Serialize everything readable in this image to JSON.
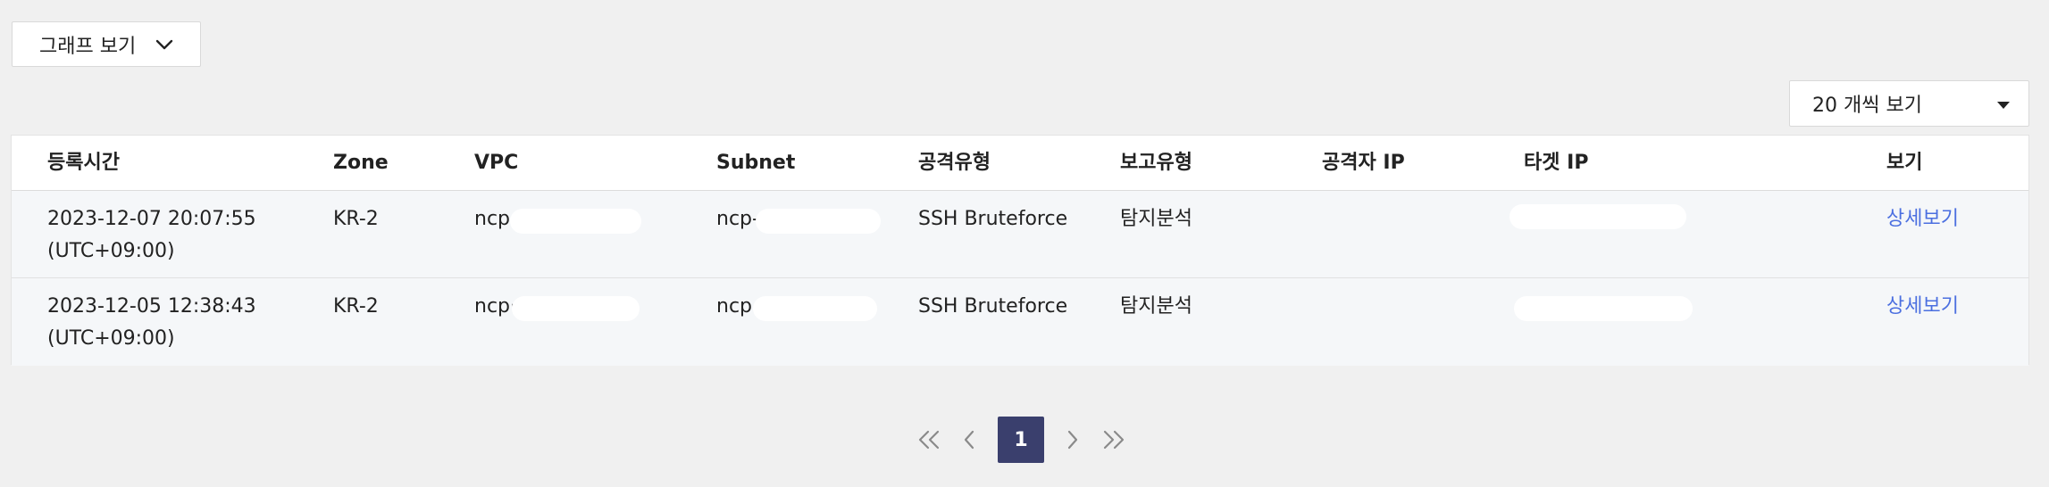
{
  "graph_toggle": {
    "label": "그래프 보기",
    "icon": "chevron-down-icon"
  },
  "page_size": {
    "selected": "20 개씩 보기",
    "icon": "caret-down-icon"
  },
  "table": {
    "columns": [
      "등록시간",
      "Zone",
      "VPC",
      "Subnet",
      "공격유형",
      "보고유형",
      "공격자 IP",
      "타겟 IP",
      "보기"
    ],
    "rows": [
      {
        "date": "2023-12-07 20:07:55",
        "tz": "(UTC+09:00)",
        "zone": "KR-2",
        "vpc": "ncp",
        "subnet": "ncp-",
        "attack_type": "SSH Bruteforce",
        "report_type": "탐지분석",
        "attacker_ip": "",
        "view": "상세보기"
      },
      {
        "date": "2023-12-05 12:38:43",
        "tz": "(UTC+09:00)",
        "zone": "KR-2",
        "vpc": "ncp·",
        "subnet": "ncp·",
        "attack_type": "SSH Bruteforce",
        "report_type": "탐지분석",
        "attacker_ip": "",
        "view": "상세보기"
      }
    ]
  },
  "pagination": {
    "current_page": "1",
    "icons": [
      "double-chevron-left-icon",
      "chevron-left-icon",
      "chevron-right-icon",
      "double-chevron-right-icon"
    ]
  },
  "colors": {
    "background": "#f0f0f0",
    "link": "#4b6fe0",
    "page_active": "#3a3f6d",
    "row_background": "#f5f7f9"
  }
}
